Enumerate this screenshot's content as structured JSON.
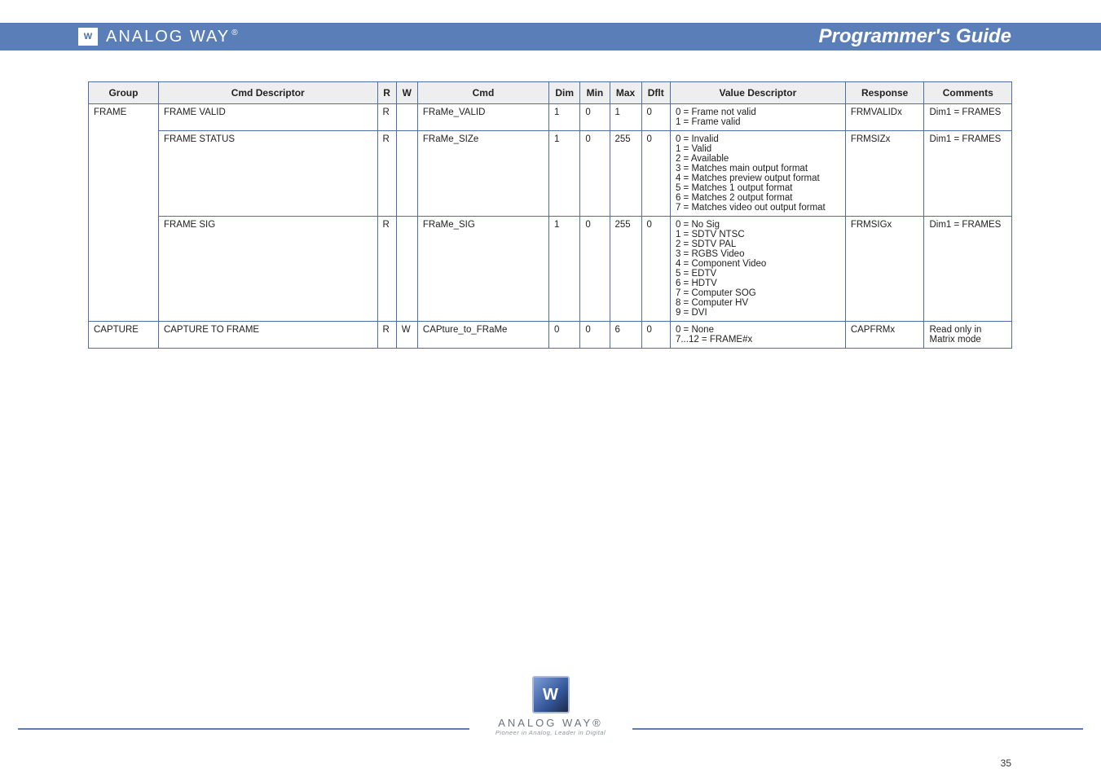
{
  "header": {
    "brand_logo_letters": "W",
    "brand_text": "ANALOG WAY",
    "brand_reg": "®",
    "guide_title": "Programmer's Guide"
  },
  "table": {
    "headers": {
      "group": "Group",
      "cmd_desc": "Cmd Descriptor",
      "r": "R",
      "w": "W",
      "cmd": "Cmd",
      "dim": "Dim",
      "min": "Min",
      "max": "Max",
      "default": "Dflt",
      "value_desc": "Value Descriptor",
      "response": "Response",
      "comments": "Comments"
    },
    "rows": [
      {
        "group": "FRAME",
        "cmd_desc": "FRAME VALID",
        "r": "R",
        "w": "",
        "cmd": "FRaMe_VALID",
        "dim": "1",
        "min": "0",
        "max": "1",
        "default": "0",
        "value_desc": "0 = Frame not valid\n1 = Frame valid",
        "response": "FRMVALIDx",
        "comments": "Dim1 = FRAMES"
      },
      {
        "group": "",
        "cmd_desc": "FRAME STATUS",
        "r": "R",
        "w": "",
        "cmd": "FRaMe_SIZe",
        "dim": "1",
        "min": "0",
        "max": "255",
        "default": "0",
        "value_desc": "0 = Invalid\n1 = Valid\n2 = Available\n3 = Matches main output format\n4 = Matches preview output format\n5 = Matches 1 output format\n6 = Matches 2 output format\n7 = Matches video out output format",
        "response": "FRMSIZx",
        "comments": "Dim1 = FRAMES"
      },
      {
        "group": "",
        "cmd_desc": "FRAME SIG",
        "r": "R",
        "w": "",
        "cmd": "FRaMe_SIG",
        "dim": "1",
        "min": "0",
        "max": "255",
        "default": "0",
        "value_desc": "0 = No Sig\n1 = SDTV NTSC\n2 = SDTV PAL\n3 = RGBS Video\n4 = Component Video\n5 = EDTV\n6 = HDTV\n7 = Computer SOG\n8 = Computer HV\n9 = DVI",
        "response": "FRMSIGx",
        "comments": "Dim1 = FRAMES"
      },
      {
        "group": "CAPTURE",
        "cmd_desc": "CAPTURE TO FRAME",
        "r": "R",
        "w": "W",
        "cmd": "CAPture_to_FRaMe",
        "dim": "0",
        "min": "0",
        "max": "6",
        "default": "0",
        "value_desc": "0 = None\n7...12 = FRAME#x",
        "response": "CAPFRMx",
        "comments": "Read only in Matrix mode"
      }
    ]
  },
  "footer": {
    "cube_letter": "W",
    "brandline": "ANALOG WAY®",
    "tagline": "Pioneer in Analog, Leader in Digital",
    "page_number": "35"
  }
}
